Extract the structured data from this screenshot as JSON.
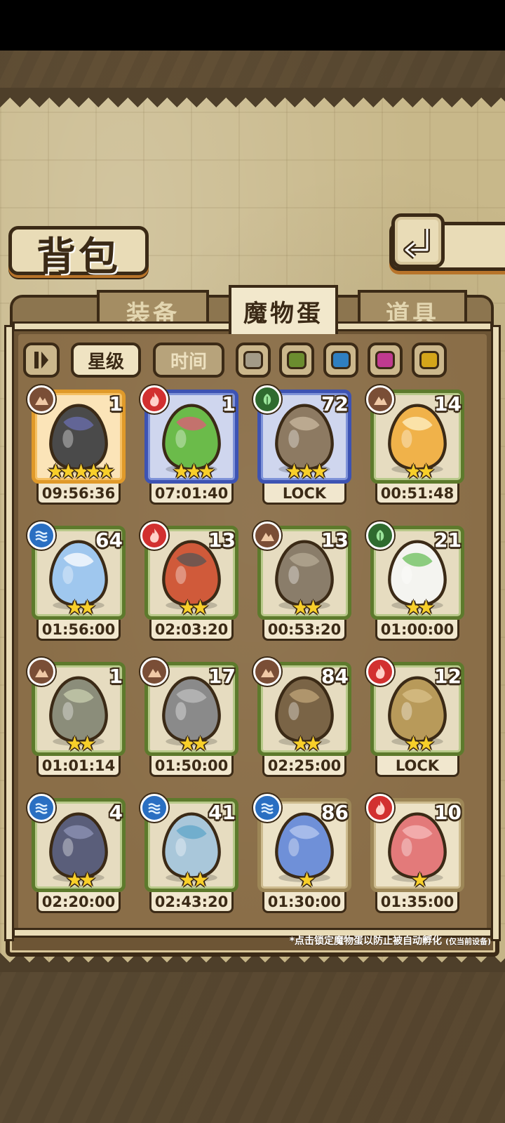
{
  "title": "背包",
  "tabs": [
    {
      "label": "装备",
      "active": false
    },
    {
      "label": "魔物蛋",
      "active": true
    },
    {
      "label": "道具",
      "active": false
    }
  ],
  "filters": {
    "sort_icon": "sort-icon",
    "star_label": "星级",
    "time_label": "时间",
    "colors": [
      "#a39b88",
      "#6b8c2f",
      "#2f7fc1",
      "#c03a8f",
      "#d4a51a"
    ]
  },
  "eggs": [
    {
      "element": "earth",
      "count": "1",
      "stars": 5,
      "timer": "09:56:36",
      "frame": "orange",
      "colors": [
        "#4a4a4a",
        "#6b6fb0"
      ]
    },
    {
      "element": "fire",
      "count": "1",
      "stars": 3,
      "timer": "07:01:40",
      "frame": "blue",
      "colors": [
        "#6bbb4a",
        "#e05a7a"
      ]
    },
    {
      "element": "grass",
      "count": "72",
      "stars": 3,
      "timer": "LOCK",
      "frame": "blue",
      "colors": [
        "#8d7a62",
        "#cbb9a0"
      ]
    },
    {
      "element": "earth",
      "count": "14",
      "stars": 2,
      "timer": "00:51:48",
      "frame": "green",
      "colors": [
        "#f0b24a",
        "#fff1c8"
      ]
    },
    {
      "element": "water",
      "count": "64",
      "stars": 2,
      "timer": "01:56:00",
      "frame": "green",
      "colors": [
        "#9fc7ee",
        "#ffffff"
      ]
    },
    {
      "element": "fire",
      "count": "13",
      "stars": 2,
      "timer": "02:03:20",
      "frame": "green",
      "colors": [
        "#d05a3a",
        "#555555"
      ]
    },
    {
      "element": "earth",
      "count": "13",
      "stars": 2,
      "timer": "00:53:20",
      "frame": "green",
      "colors": [
        "#8a7d6a",
        "#b5ab96"
      ]
    },
    {
      "element": "grass",
      "count": "21",
      "stars": 2,
      "timer": "01:00:00",
      "frame": "green",
      "colors": [
        "#f4f4f0",
        "#6abf5a"
      ]
    },
    {
      "element": "earth",
      "count": "1",
      "stars": 2,
      "timer": "01:01:14",
      "frame": "green",
      "colors": [
        "#8b8d7a",
        "#c9d0b0"
      ]
    },
    {
      "element": "earth",
      "count": "17",
      "stars": 2,
      "timer": "01:50:00",
      "frame": "green",
      "colors": [
        "#8a8a8a",
        "#bdbdbd"
      ]
    },
    {
      "element": "earth",
      "count": "84",
      "stars": 2,
      "timer": "02:25:00",
      "frame": "green",
      "colors": [
        "#7a6446",
        "#c2a67a"
      ]
    },
    {
      "element": "fire",
      "count": "12",
      "stars": 2,
      "timer": "LOCK",
      "frame": "green",
      "colors": [
        "#b89a5a",
        "#d9c08a"
      ]
    },
    {
      "element": "water",
      "count": "4",
      "stars": 2,
      "timer": "02:20:00",
      "frame": "green",
      "colors": [
        "#5a5e7a",
        "#9096b8"
      ]
    },
    {
      "element": "water",
      "count": "41",
      "stars": 2,
      "timer": "02:43:20",
      "frame": "green",
      "colors": [
        "#a9c7da",
        "#5fa6c8"
      ]
    },
    {
      "element": "water",
      "count": "86",
      "stars": 1,
      "timer": "01:30:00",
      "frame": "tan",
      "colors": [
        "#6f90d8",
        "#b8c9f0"
      ]
    },
    {
      "element": "fire",
      "count": "10",
      "stars": 1,
      "timer": "01:35:00",
      "frame": "tan",
      "colors": [
        "#e37a7a",
        "#f7bcbc"
      ]
    }
  ],
  "note_main": "*点击锁定魔物蛋以防止被自动孵化",
  "note_small": "(仅当前设备)"
}
